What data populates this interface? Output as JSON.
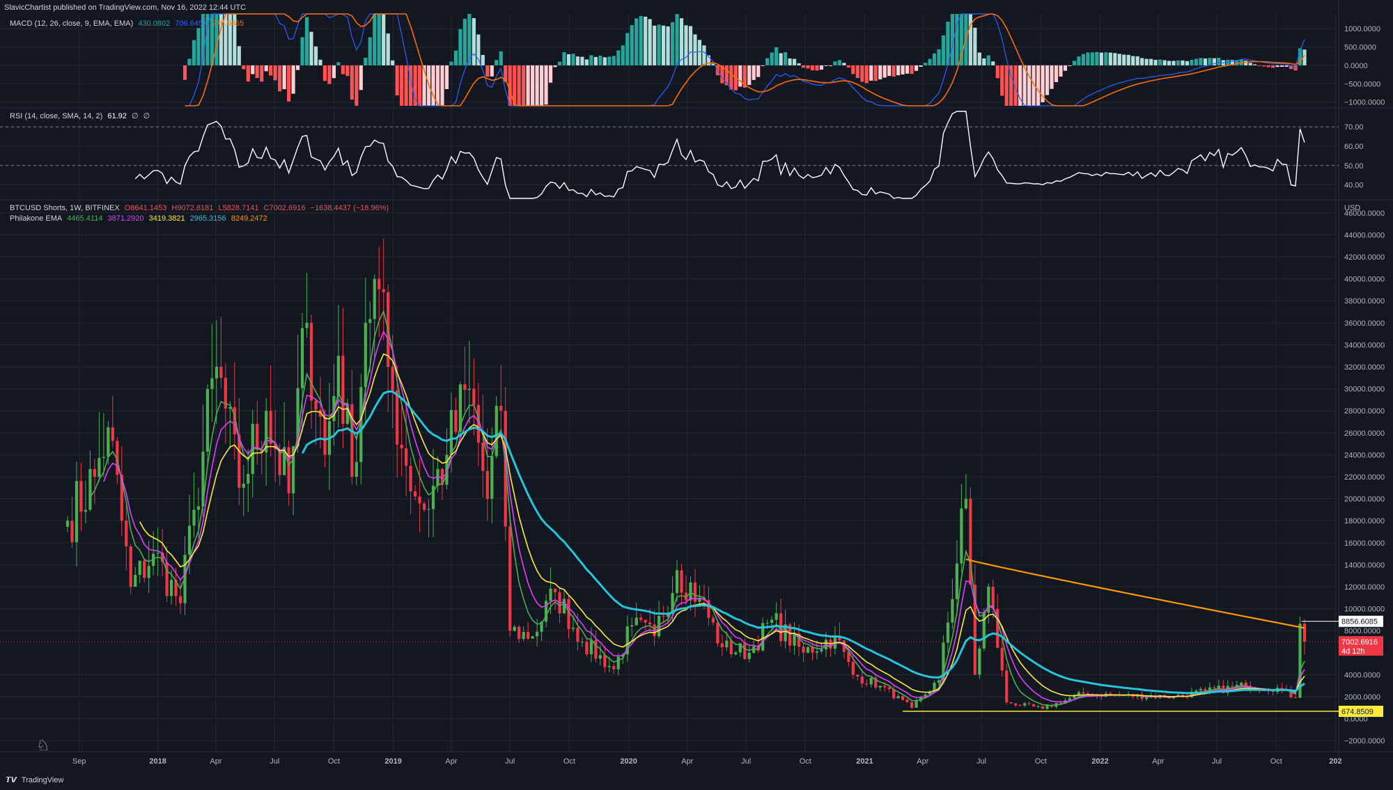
{
  "header": {
    "publisher": "SlavicChartist published on TradingView.com, Nov 16, 2022 12:44 UTC"
  },
  "footer": {
    "brand": "TradingView"
  },
  "colors": {
    "background": "#131722",
    "grid": "#242832",
    "axis_text": "#b2b5be",
    "up": "#26a69a",
    "down": "#ef5350",
    "candle_up": "#4caf50",
    "candle_down": "#f23645",
    "macd_line": "#2962ff",
    "signal_line": "#ff6d00",
    "hist_up_strong": "#26a69a",
    "hist_up_weak": "#b2dfdb",
    "hist_down_strong": "#ff5252",
    "hist_down_weak": "#ffcdd2",
    "rsi": "#ffffff",
    "ema1": "#4caf50",
    "ema2": "#e040fb",
    "ema3": "#ffeb3b",
    "ema4": "#26c6da",
    "ema5": "#ff9800",
    "support": "#ffeb3b"
  },
  "macd_legend": {
    "label": "MACD (12, 26, close, 9, EMA, EMA)",
    "v1": "430.0802",
    "v2": "706.6457",
    "v3": "276.5655"
  },
  "rsi_legend": {
    "label": "RSI (14, close, SMA, 14, 2)",
    "v1": "61.92",
    "v2": "∅",
    "v3": "∅"
  },
  "price_legend": {
    "symbol": "BTCUSD Shorts, 1W, BITFINEX",
    "o": "O8641.1453",
    "h": "H9072.8181",
    "l": "L5828.7141",
    "c": "C7002.6916",
    "chg": "−1638.4437 (−18.96%)"
  },
  "ema_legend": {
    "label": "Philakone EMA",
    "v1": "4465.4114",
    "v2": "3871.2920",
    "v3": "3419.3821",
    "v4": "2965.3156",
    "v5": "8249.2472"
  },
  "price_axis": {
    "currency": "USD",
    "ticks": [
      "46000.0000",
      "44000.0000",
      "42000.0000",
      "40000.0000",
      "38000.0000",
      "36000.0000",
      "34000.0000",
      "32000.0000",
      "30000.0000",
      "28000.0000",
      "26000.0000",
      "24000.0000",
      "22000.0000",
      "20000.0000",
      "18000.0000",
      "16000.0000",
      "14000.0000",
      "12000.0000",
      "10000.0000",
      "8000.0000",
      "4000.0000",
      "2000.0000",
      "0.0000",
      "−2000.0000"
    ],
    "labels": [
      {
        "text": "8856.6085",
        "kind": "white"
      },
      {
        "text": "7002.6916",
        "sub": "4d 12h",
        "kind": "red"
      },
      {
        "text": "674.8509",
        "kind": "yellow"
      }
    ]
  },
  "macd_axis": {
    "ticks": [
      "1000.0000",
      "500.0000",
      "0.0000",
      "−500.0000",
      "−1000.0000"
    ]
  },
  "rsi_axis": {
    "ticks": [
      "70.00",
      "60.00",
      "50.00",
      "40.00"
    ]
  },
  "time_axis": {
    "ticks": [
      "Sep",
      "2018",
      "Apr",
      "Jul",
      "Oct",
      "2019",
      "Apr",
      "Jul",
      "Oct",
      "2020",
      "Apr",
      "Jul",
      "Oct",
      "2021",
      "Apr",
      "Jul",
      "Oct",
      "2022",
      "Apr",
      "Jul",
      "Oct",
      "202"
    ]
  },
  "chart_data": [
    {
      "type": "candlestick",
      "title": "BTCUSD Shorts, 1W, BITFINEX",
      "ylabel": "USD",
      "ylim": [
        -3000,
        47000
      ],
      "x_start": "2017-08-14",
      "x_end": "2022-11-14",
      "interval": "1W",
      "support_level": 674.8509,
      "reference_level": 8856.6085,
      "last_close": 7002.6916,
      "ohlc_keypoints": [
        [
          "2017-08-14",
          18000
        ],
        [
          "2017-09-25",
          22000
        ],
        [
          "2017-10-16",
          26500
        ],
        [
          "2017-11-20",
          12000
        ],
        [
          "2017-12-25",
          15000
        ],
        [
          "2018-02-05",
          10500
        ],
        [
          "2018-02-26",
          19000
        ],
        [
          "2018-04-02",
          32000
        ],
        [
          "2018-05-07",
          21000
        ],
        [
          "2018-06-18",
          28000
        ],
        [
          "2018-07-23",
          20500
        ],
        [
          "2018-08-20",
          36000
        ],
        [
          "2018-09-17",
          24000
        ],
        [
          "2018-10-08",
          33000
        ],
        [
          "2018-10-29",
          22000
        ],
        [
          "2018-11-19",
          36000
        ],
        [
          "2018-12-03",
          40000
        ],
        [
          "2018-12-24",
          32000
        ],
        [
          "2019-01-21",
          23000
        ],
        [
          "2019-02-18",
          19000
        ],
        [
          "2019-03-25",
          24000
        ],
        [
          "2019-04-29",
          30000
        ],
        [
          "2019-05-27",
          20000
        ],
        [
          "2019-06-17",
          28000
        ],
        [
          "2019-07-01",
          8000
        ],
        [
          "2019-08-05",
          7500
        ],
        [
          "2019-09-09",
          11500
        ],
        [
          "2019-10-21",
          7000
        ],
        [
          "2019-12-09",
          4500
        ],
        [
          "2020-01-06",
          8500
        ],
        [
          "2020-02-10",
          7500
        ],
        [
          "2020-03-16",
          13500
        ],
        [
          "2020-04-20",
          11000
        ],
        [
          "2020-05-25",
          6500
        ],
        [
          "2020-07-06",
          6000
        ],
        [
          "2020-08-10",
          9000
        ],
        [
          "2020-09-28",
          6000
        ],
        [
          "2020-11-16",
          7500
        ],
        [
          "2020-12-14",
          4000
        ],
        [
          "2021-01-25",
          3000
        ],
        [
          "2021-03-15",
          1000
        ],
        [
          "2021-04-26",
          3500
        ],
        [
          "2021-06-07",
          20000
        ],
        [
          "2021-06-21",
          4000
        ],
        [
          "2021-07-12",
          12000
        ],
        [
          "2021-08-09",
          1500
        ],
        [
          "2021-10-04",
          900
        ],
        [
          "2021-12-06",
          2300
        ],
        [
          "2022-02-07",
          2100
        ],
        [
          "2022-04-25",
          2000
        ],
        [
          "2022-06-13",
          2500
        ],
        [
          "2022-08-15",
          3000
        ],
        [
          "2022-10-03",
          2800
        ],
        [
          "2022-10-31",
          1900
        ],
        [
          "2022-11-07",
          8641
        ],
        [
          "2022-11-14",
          7003
        ]
      ],
      "series": [
        {
          "name": "Philakone EMA 1",
          "last": 4465.4114
        },
        {
          "name": "Philakone EMA 2",
          "last": 3871.292
        },
        {
          "name": "Philakone EMA 3",
          "last": 3419.3821
        },
        {
          "name": "Philakone EMA 4",
          "last": 2965.3156
        },
        {
          "name": "Philakone EMA 5",
          "last": 8249.2472
        }
      ]
    },
    {
      "type": "bar",
      "title": "MACD (12, 26, close, 9, EMA, EMA)",
      "ylim": [
        -1100,
        1400
      ],
      "last_histogram": 430.0802,
      "last_macd": 706.6457,
      "last_signal": 276.5655
    },
    {
      "type": "line",
      "title": "RSI (14, close, SMA, 14, 2)",
      "ylim": [
        33,
        78
      ],
      "bands": [
        70,
        50
      ],
      "last_value": 61.92
    }
  ]
}
